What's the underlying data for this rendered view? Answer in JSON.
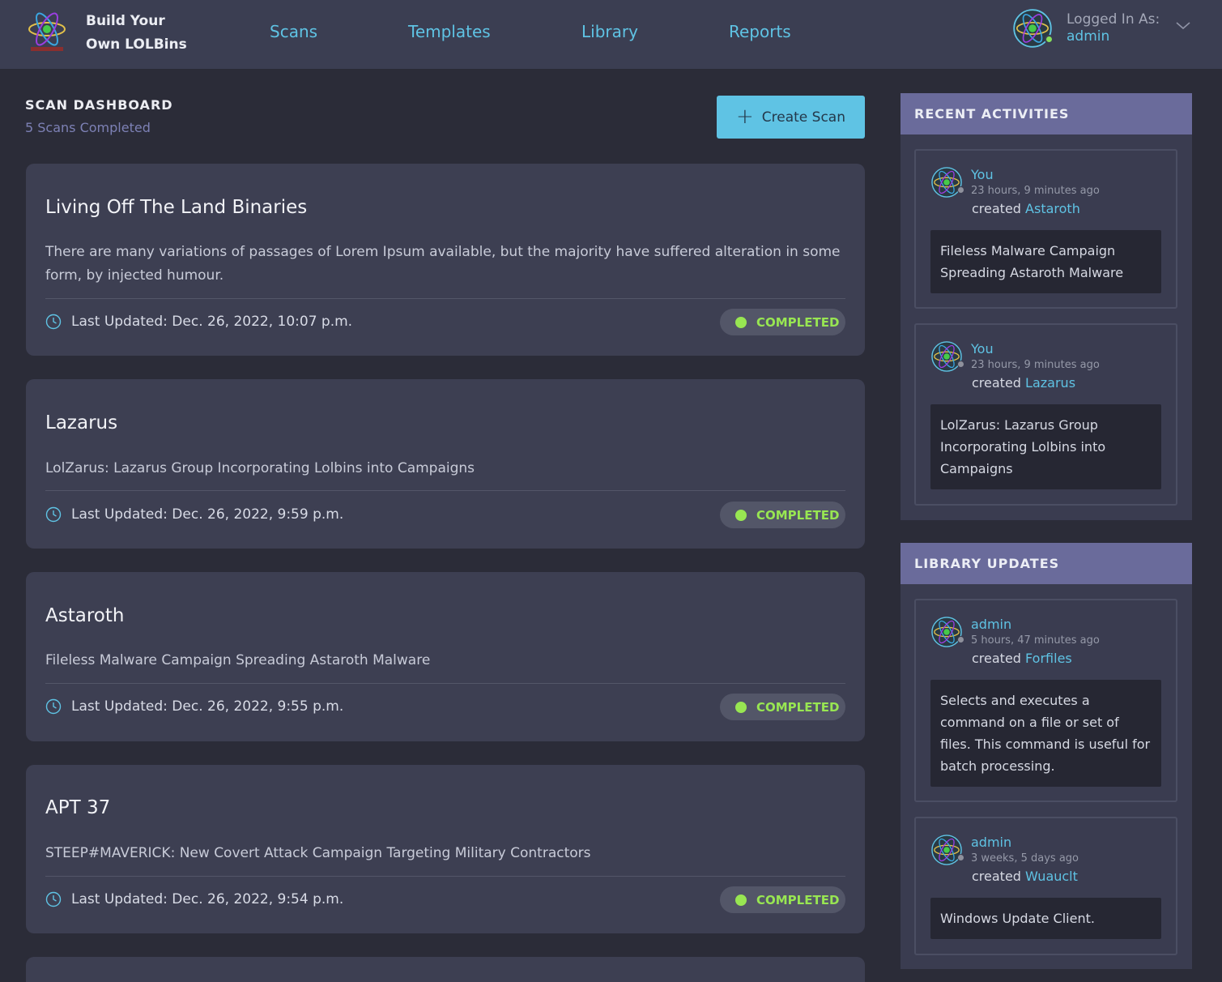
{
  "header": {
    "brand_line1": "Build Your",
    "brand_line2": "Own LOLBins",
    "nav": [
      "Scans",
      "Templates",
      "Library",
      "Reports"
    ],
    "logged_in_label": "Logged In As:",
    "username": "admin"
  },
  "dashboard": {
    "title": "SCAN DASHBOARD",
    "subtitle": "5 Scans Completed",
    "create_button": "Create Scan"
  },
  "scans": [
    {
      "title": "Living Off The Land Binaries",
      "description": "There are many variations of passages of Lorem Ipsum available, but the majority have suffered alteration in some form, by injected humour.",
      "updated": "Last Updated: Dec. 26, 2022, 10:07 p.m.",
      "status": "COMPLETED"
    },
    {
      "title": "Lazarus",
      "description": "LolZarus: Lazarus Group Incorporating Lolbins into Campaigns",
      "updated": "Last Updated: Dec. 26, 2022, 9:59 p.m.",
      "status": "COMPLETED"
    },
    {
      "title": "Astaroth",
      "description": "Fileless Malware Campaign Spreading Astaroth Malware",
      "updated": "Last Updated: Dec. 26, 2022, 9:55 p.m.",
      "status": "COMPLETED"
    },
    {
      "title": "APT 37",
      "description": "STEEP#MAVERICK: New Covert Attack Campaign Targeting Military Contractors",
      "updated": "Last Updated: Dec. 26, 2022, 9:54 p.m.",
      "status": "COMPLETED"
    }
  ],
  "recent_activities": {
    "title": "RECENT ACTIVITIES",
    "items": [
      {
        "user": "You",
        "time": "23 hours, 9 minutes ago",
        "action": "created",
        "target": "Astaroth",
        "detail": "Fileless Malware Campaign Spreading Astaroth Malware"
      },
      {
        "user": "You",
        "time": "23 hours, 9 minutes ago",
        "action": "created",
        "target": "Lazarus",
        "detail": "LolZarus: Lazarus Group Incorporating Lolbins into Campaigns"
      }
    ]
  },
  "library_updates": {
    "title": "LIBRARY UPDATES",
    "items": [
      {
        "user": "admin",
        "time": "5 hours, 47 minutes ago",
        "action": "created",
        "target": "Forfiles",
        "detail": "Selects and executes a command on a file or set of files. This command is useful for batch processing."
      },
      {
        "user": "admin",
        "time": "3 weeks, 5 days ago",
        "action": "created",
        "target": "Wuauclt",
        "detail": "Windows Update Client."
      }
    ]
  },
  "colors": {
    "accent": "#5fc3e4",
    "completed": "#98e652",
    "panel_header": "#6a6b9b",
    "background": "#2b2c38",
    "card": "#3d3f52"
  },
  "icons": {
    "logo": "atom-logo-icon",
    "clock": "clock-icon",
    "plus": "plus-icon",
    "chevron": "chevron-down-icon"
  }
}
